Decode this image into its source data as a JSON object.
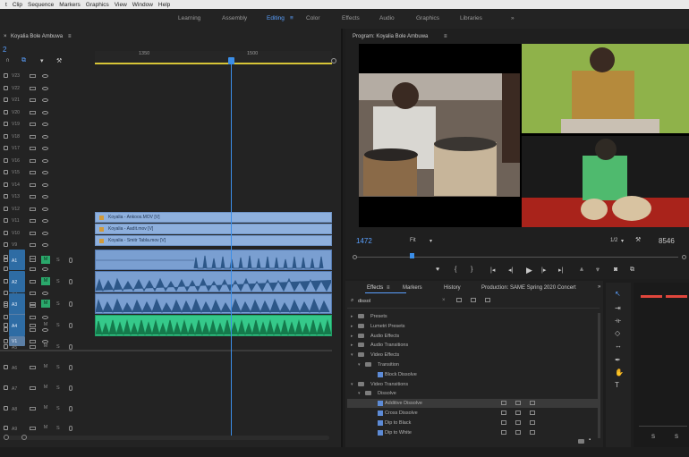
{
  "menubar": {
    "items": [
      "t",
      "Clip",
      "Sequence",
      "Markers",
      "Graphics",
      "View",
      "Window",
      "Help"
    ]
  },
  "workspaces": {
    "tabs": [
      "Learning",
      "Assembly",
      "Editing",
      "Color",
      "Effects",
      "Audio",
      "Graphics",
      "Libraries"
    ],
    "active": "Editing",
    "more": "»"
  },
  "timeline": {
    "tab": "Koyalia Bole Ambuwa",
    "timecode": "2",
    "ruler_labels": [
      "1350",
      "1500"
    ],
    "video_tracks": [
      "V23",
      "V22",
      "V21",
      "V20",
      "V19",
      "V18",
      "V17",
      "V16",
      "V15",
      "V14",
      "V13",
      "V12",
      "V11",
      "V10",
      "V9",
      "V8",
      "V7",
      "V6",
      "V5",
      "V4",
      "V3",
      "V2",
      "V1"
    ],
    "clips_video": [
      "Koyalia - Ankoos.MOV [V]",
      "Koyalia - Aadit.mov [V]",
      "Koyalia - Smitr Tabla.mov [V]"
    ],
    "audio_tracks": [
      {
        "name": "A1",
        "m": "M",
        "s": "S"
      },
      {
        "name": "A2",
        "m": "M",
        "s": "S"
      },
      {
        "name": "A3",
        "m": "M",
        "s": "S"
      },
      {
        "name": "A4",
        "m": "M",
        "s": "S"
      },
      {
        "name": "A5",
        "m": "M",
        "s": "S"
      },
      {
        "name": "A6",
        "m": "M",
        "s": "S"
      },
      {
        "name": "A7",
        "m": "M",
        "s": "S"
      },
      {
        "name": "A8",
        "m": "M",
        "s": "S"
      },
      {
        "name": "A9",
        "m": "M",
        "s": "S"
      }
    ]
  },
  "program": {
    "title": "Program: Koyalia Bole Ambuwa",
    "timecode_left": "1472",
    "fit": "Fit",
    "resolution": "1/2",
    "timecode_right": "8546"
  },
  "effects": {
    "tabs": [
      "Effects",
      "Markers",
      "History",
      "Production: SAME Spring 2020 Concert"
    ],
    "search": "dissol",
    "items": [
      {
        "label": "Presets",
        "level": 0,
        "type": "folder"
      },
      {
        "label": "Lumetri Presets",
        "level": 0,
        "type": "folder"
      },
      {
        "label": "Audio Effects",
        "level": 0,
        "type": "folder"
      },
      {
        "label": "Audio Transitions",
        "level": 0,
        "type": "folder"
      },
      {
        "label": "Video Effects",
        "level": 0,
        "type": "folder"
      },
      {
        "label": "Transition",
        "level": 1,
        "type": "folder"
      },
      {
        "label": "Block Dissolve",
        "level": 2,
        "type": "fx"
      },
      {
        "label": "Video Transitions",
        "level": 0,
        "type": "folder"
      },
      {
        "label": "Dissolve",
        "level": 1,
        "type": "folder"
      },
      {
        "label": "Additive Dissolve",
        "level": 2,
        "type": "fx"
      },
      {
        "label": "Cross Dissolve",
        "level": 2,
        "type": "fx"
      },
      {
        "label": "Dip to Black",
        "level": 2,
        "type": "fx"
      },
      {
        "label": "Dip to White",
        "level": 2,
        "type": "fx"
      }
    ]
  },
  "meters": {
    "labels": [
      "S",
      "S"
    ]
  },
  "colors": {
    "accent": "#5aa0ff",
    "audio_green": "#35c98a",
    "video_clip": "#8eb0dd",
    "playhead": "#3b8ee8"
  }
}
